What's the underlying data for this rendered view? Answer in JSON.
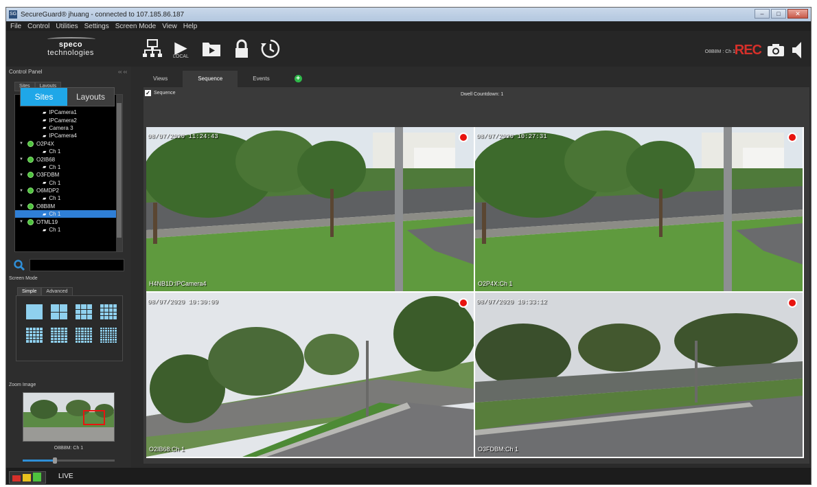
{
  "window": {
    "title": "SecureGuard® jhuang - connected to 107.185.86.187",
    "minimize": "–",
    "maximize": "□",
    "close": "✕"
  },
  "menu": [
    "File",
    "Control",
    "Utilities",
    "Settings",
    "Screen Mode",
    "View",
    "Help"
  ],
  "toolbar": {
    "brand_bold": "speco",
    "brand_rest": " technologies",
    "local_label": "LOCAL",
    "status_camera": "O8B8M : Ch 1",
    "rec_label": "REC",
    "icons": [
      "network-icon",
      "play-local-icon",
      "playback-folder-icon",
      "lock-icon",
      "history-icon",
      "snapshot-icon",
      "speaker-icon"
    ]
  },
  "left_panel": {
    "title": "Control Panel",
    "pin": "‹‹ ‹‹",
    "sites_tabs": [
      "Sites",
      "Layouts"
    ],
    "popup_tabs": [
      "Sites",
      "Layouts"
    ],
    "tree": [
      {
        "type": "camera",
        "label": "IPCamera1"
      },
      {
        "type": "camera",
        "label": "IPCamera2"
      },
      {
        "type": "camera",
        "label": "Camera 3"
      },
      {
        "type": "camera",
        "label": "IPCamera4"
      },
      {
        "type": "site",
        "label": "O2P4X"
      },
      {
        "type": "camera",
        "label": "Ch 1"
      },
      {
        "type": "site",
        "label": "O2IB68"
      },
      {
        "type": "camera",
        "label": "Ch 1"
      },
      {
        "type": "site",
        "label": "O3FDBM"
      },
      {
        "type": "camera",
        "label": "Ch 1"
      },
      {
        "type": "site",
        "label": "O6MDP2"
      },
      {
        "type": "camera",
        "label": "Ch 1"
      },
      {
        "type": "site",
        "label": "O8B8M"
      },
      {
        "type": "camera",
        "label": "Ch 1",
        "selected": true
      },
      {
        "type": "site",
        "label": "OTML19"
      },
      {
        "type": "camera",
        "label": "Ch 1"
      }
    ],
    "search": {
      "value": "",
      "placeholder": ""
    },
    "screen_mode_label": "Screen Mode",
    "screen_mode_tabs": [
      "Simple",
      "Advanced"
    ],
    "zoom_label": "Zoom Image",
    "zoom_caption": "O8B8M: Ch 1",
    "zoom_level": 0.35
  },
  "main": {
    "tabs": [
      "Views",
      "Sequence",
      "Events"
    ],
    "active_tab": "Sequence",
    "sequence_label": "Sequence",
    "sequence_checked": "✓",
    "dwell": "Dwell Countdown: 1",
    "feeds": [
      {
        "timestamp": "08/07/2020 11:24:43",
        "label": "H4NB1D:IPCamera4"
      },
      {
        "timestamp": "08/07/2020 10:27:31",
        "label": "O2P4X:Ch 1"
      },
      {
        "timestamp": "08/07/2020 10:30:09",
        "label": "O2IB68:Ch 1"
      },
      {
        "timestamp": "08/07/2020 10:33:12",
        "label": "O3FDBM:Ch 1"
      }
    ]
  },
  "status": {
    "live_label": "LIVE"
  },
  "colors": {
    "accent": "#1fa7e8",
    "rec": "#d6302a",
    "record_dot": "#e8140f",
    "online": "#4ec23e",
    "selection": "#2f7fd6"
  }
}
